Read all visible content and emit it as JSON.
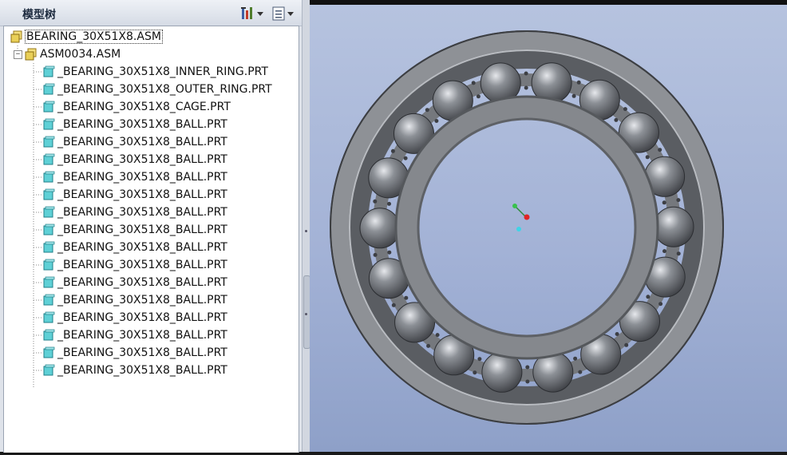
{
  "panel": {
    "title": "模型树"
  },
  "tree": {
    "root": "BEARING_30X51X8.ASM",
    "subassembly": "ASM0034.ASM",
    "parts": [
      "_BEARING_30X51X8_INNER_RING.PRT",
      "_BEARING_30X51X8_OUTER_RING.PRT",
      "_BEARING_30X51X8_CAGE.PRT",
      "_BEARING_30X51X8_BALL.PRT",
      "_BEARING_30X51X8_BALL.PRT",
      "_BEARING_30X51X8_BALL.PRT",
      "_BEARING_30X51X8_BALL.PRT",
      "_BEARING_30X51X8_BALL.PRT",
      "_BEARING_30X51X8_BALL.PRT",
      "_BEARING_30X51X8_BALL.PRT",
      "_BEARING_30X51X8_BALL.PRT",
      "_BEARING_30X51X8_BALL.PRT",
      "_BEARING_30X51X8_BALL.PRT",
      "_BEARING_30X51X8_BALL.PRT",
      "_BEARING_30X51X8_BALL.PRT",
      "_BEARING_30X51X8_BALL.PRT",
      "_BEARING_30X51X8_BALL.PRT",
      "_BEARING_30X51X8_BALL.PRT"
    ]
  },
  "toolbar": {
    "settings_icon": "tools-icon",
    "show_icon": "list-icon"
  },
  "colors": {
    "viewport_top": "#b6c3df",
    "viewport_bottom": "#8ea0c8",
    "part_icon": "#5fd0d6",
    "asm_icon": "#e9cf57"
  }
}
